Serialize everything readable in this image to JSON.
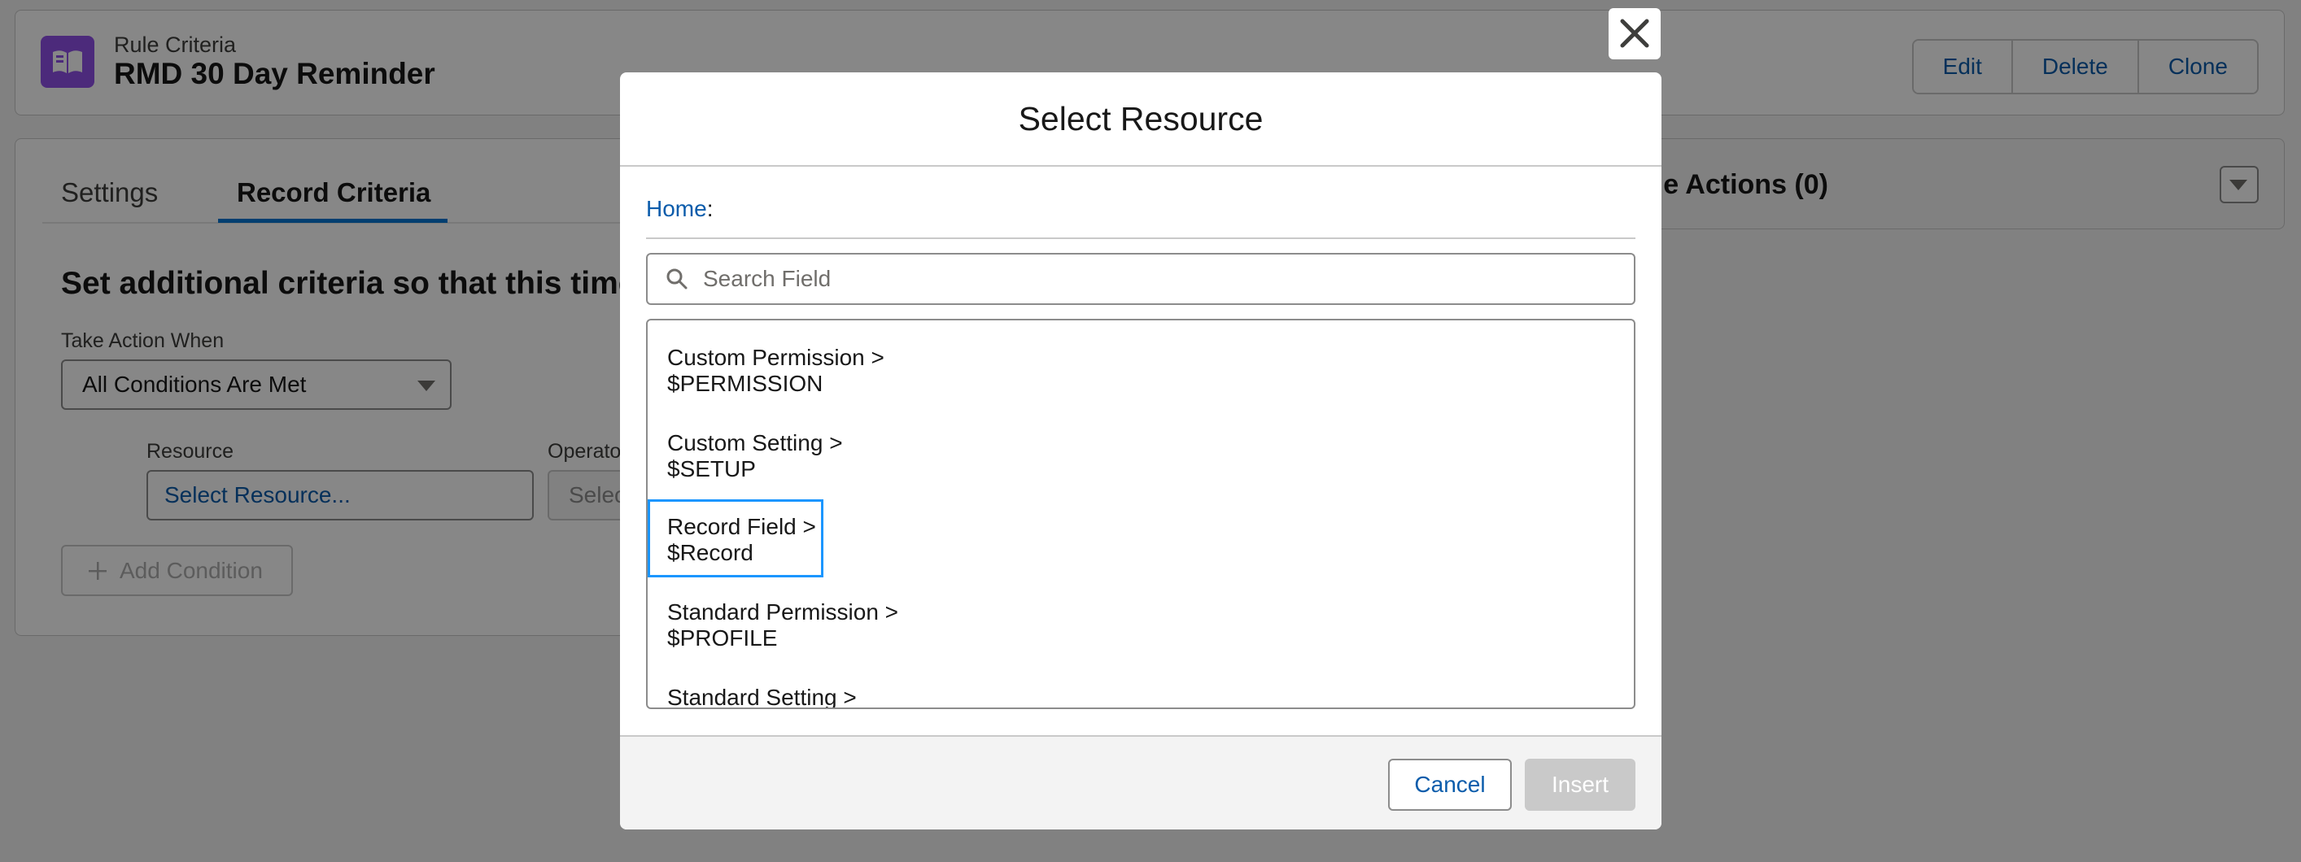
{
  "header": {
    "object_type": "Rule Criteria",
    "record_title": "RMD 30 Day Reminder",
    "buttons": [
      "Edit",
      "Delete",
      "Clone"
    ]
  },
  "tabs": [
    {
      "label": "Settings",
      "active": false
    },
    {
      "label": "Record Criteria",
      "active": true
    }
  ],
  "criteria": {
    "instruction": "Set additional criteria so that this time-b",
    "take_action_label": "Take Action When",
    "take_action_value": "All Conditions Are Met",
    "resource_label": "Resource",
    "resource_placeholder": "Select Resource...",
    "operator_label": "Operato",
    "operator_placeholder": "Selec",
    "add_condition": "Add Condition"
  },
  "actions_panel": {
    "title": "ule Actions (0)"
  },
  "modal": {
    "title": "Select Resource",
    "breadcrumb_home": "Home",
    "breadcrumb_sep": ":",
    "search_placeholder": "Search Field",
    "items": [
      {
        "label": "Custom Permission >",
        "value": "$PERMISSION"
      },
      {
        "label": "Custom Setting >",
        "value": "$SETUP"
      },
      {
        "label": "Record Field >",
        "value": "$Record",
        "focused": true
      },
      {
        "label": "Standard Permission >",
        "value": "$PROFILE"
      },
      {
        "label": "Standard Setting >",
        "value": ""
      }
    ],
    "cancel_label": "Cancel",
    "insert_label": "Insert"
  },
  "colors": {
    "brand_blue": "#0176d3",
    "link_blue": "#0b5cab",
    "app_icon_purple": "#9050e9",
    "focus_ring": "#1b96ff"
  },
  "icons": [
    "book-icon",
    "chevron-down-icon",
    "plus-icon",
    "close-icon",
    "search-icon"
  ]
}
